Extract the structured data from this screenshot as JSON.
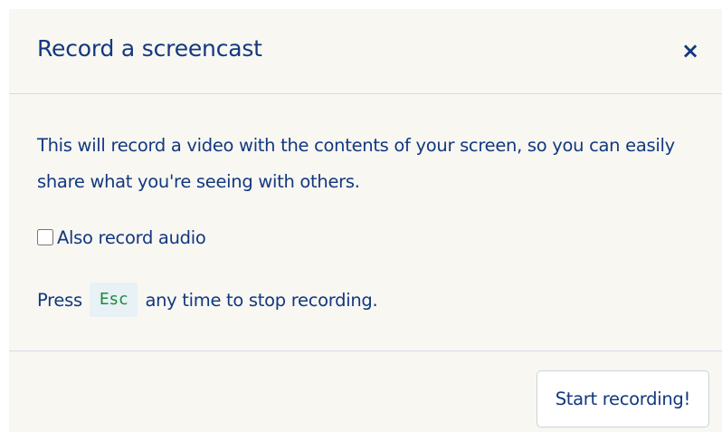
{
  "dialog": {
    "title": "Record a screencast",
    "close_label": "×",
    "description": "This will record a video with the contents of your screen, so you can easily share what you're seeing with others.",
    "audio_option": {
      "label": "Also record audio",
      "checked": false
    },
    "hint": {
      "before": "Press",
      "key": "Esc",
      "after": "any time to stop recording."
    },
    "start_button_label": "Start recording!"
  },
  "colors": {
    "text": "#12387f",
    "background": "#f8f7f2",
    "divider": "#d6dbe2",
    "key_text": "#1f8a3c",
    "key_background": "#e7f1f6"
  }
}
